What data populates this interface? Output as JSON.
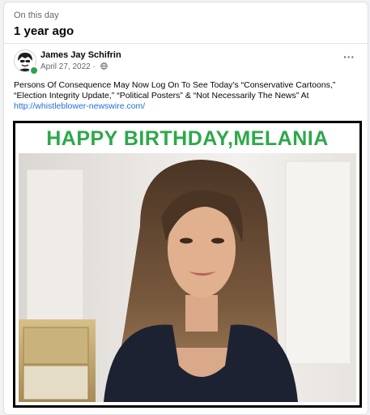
{
  "memory": {
    "label": "On this day",
    "time_ago": "1 year ago"
  },
  "post": {
    "author": "James Jay Schifrin",
    "date": "April 27, 2022",
    "date_separator": "·",
    "privacy_icon": "globe-icon",
    "more_label": "···",
    "text": "Persons Of Consequence May Now Log On To See Today's “Conservative Cartoons,” “Election Integrity Update,” “Political Posters” & “Not Necessarily The News” At ",
    "link": "http://whistleblower-newswire.com/"
  },
  "image": {
    "caption": "HAPPY BIRTHDAY,MELANIA",
    "caption_color": "#2da84a"
  },
  "colors": {
    "link": "#216fdb",
    "online": "#31a24c",
    "secondary_text": "#65676b"
  }
}
